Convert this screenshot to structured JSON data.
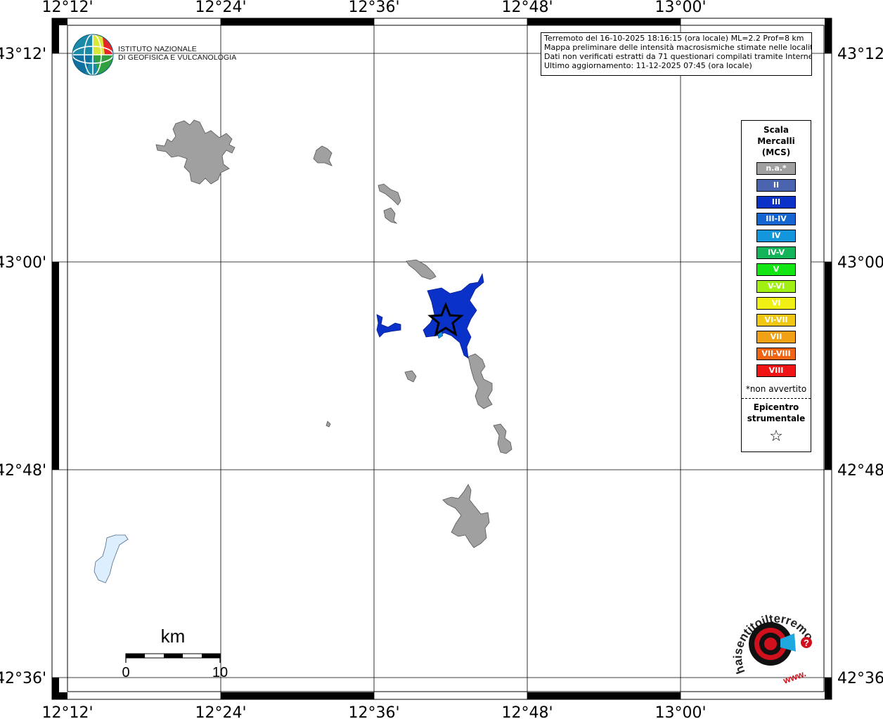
{
  "map": {
    "longitude_labels": [
      "12°12'",
      "12°24'",
      "12°36'",
      "12°48'",
      "13°00'"
    ],
    "latitude_labels": [
      "43°12'",
      "43°00'",
      "42°48'",
      "42°36'"
    ]
  },
  "info_box": {
    "line1": "Terremoto del 16-10-2025 18:16:15 (ora locale) ML=2.2 Prof=8 km",
    "line2": "Mappa preliminare delle intensità macrosismiche stimate nelle località",
    "line3": "Dati non verificati estratti da 71 questionari compilati tramite Internet.",
    "line4": "Ultimo aggiornamento: 11-12-2025 07:45 (ora locale)"
  },
  "logo_ingv": {
    "line1": "ISTITUTO NAZIONALE",
    "line2": "DI GEOFISICA E VULCANOLOGIA"
  },
  "legend": {
    "title_line1": "Scala",
    "title_line2": "Mercalli",
    "title_line3": "(MCS)",
    "items": [
      {
        "label": "n.a.*",
        "color": "#a0a0a0"
      },
      {
        "label": "II",
        "color": "#4a64b0"
      },
      {
        "label": "III",
        "color": "#0a32c8"
      },
      {
        "label": "III-IV",
        "color": "#1464d2"
      },
      {
        "label": "IV",
        "color": "#1496dc"
      },
      {
        "label": "IV-V",
        "color": "#14b45a"
      },
      {
        "label": "V",
        "color": "#14e614"
      },
      {
        "label": "V-VI",
        "color": "#a0f014"
      },
      {
        "label": "VI",
        "color": "#f0f014"
      },
      {
        "label": "VI-VII",
        "color": "#f0c814"
      },
      {
        "label": "VII",
        "color": "#f0a014"
      },
      {
        "label": "VII-VIII",
        "color": "#f06414"
      },
      {
        "label": "VIII",
        "color": "#f01414"
      }
    ],
    "note": "*non avvertito",
    "epicenter_line1": "Epicentro",
    "epicenter_line2": "strumentale",
    "epicenter_symbol": "☆"
  },
  "scale_bar": {
    "unit": "km",
    "start": "0",
    "end": "10"
  },
  "logo_hsit": {
    "text": "haisentitoilterremoto.it",
    "www": "www.",
    "question": "?"
  },
  "colors": {
    "felt_area": "#0a32c8",
    "not_available_area": "#a0a0a0",
    "lake": "#ddeeff",
    "hsit_red": "#d0101c"
  }
}
